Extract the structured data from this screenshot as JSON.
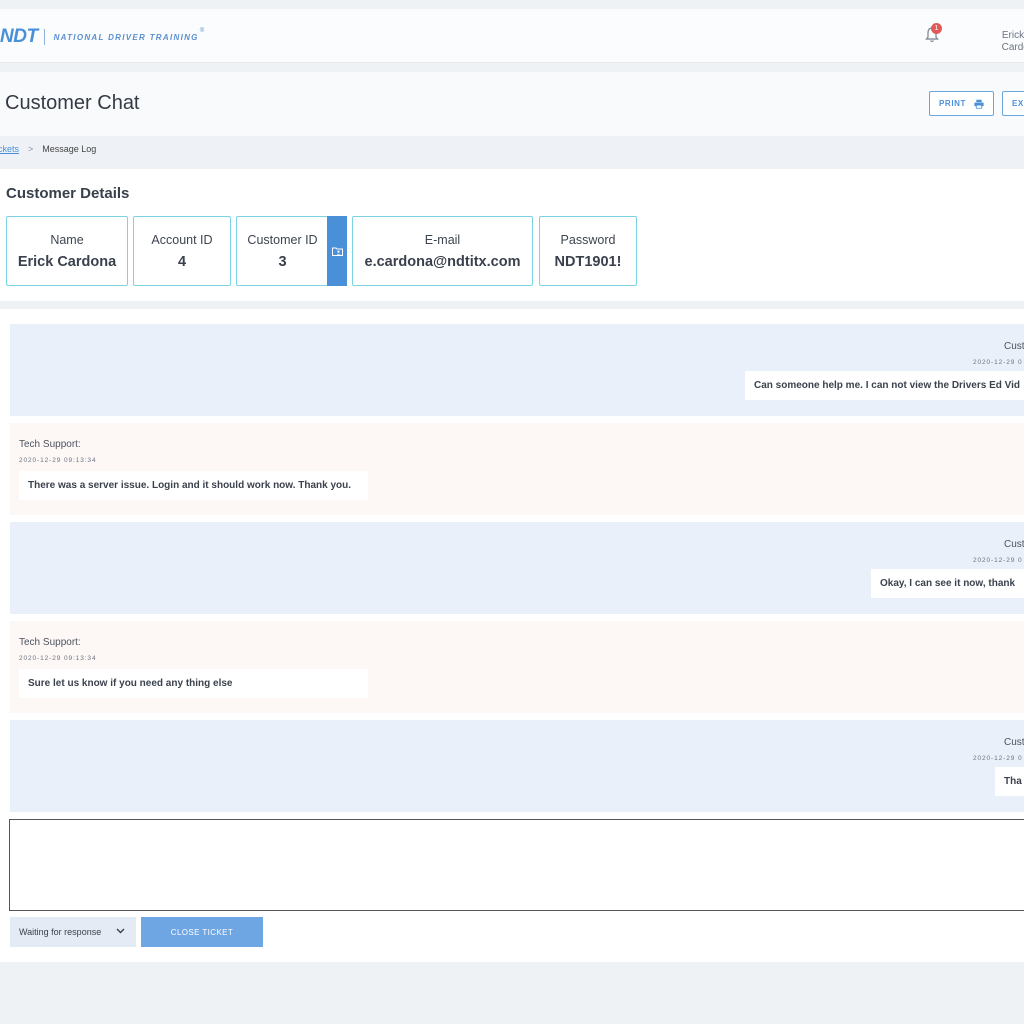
{
  "header": {
    "logo_mark": "NDT",
    "logo_text": "National Driver Training",
    "logo_reg": "®",
    "notification_count": "1",
    "user_first": "Erick C",
    "user_last": "Cardon"
  },
  "page": {
    "title": "Customer Chat",
    "print_label": "PRINT",
    "exit_label": "EXI"
  },
  "breadcrumb": {
    "link": "ckets",
    "separator": ">",
    "current": "Message Log"
  },
  "customer": {
    "section_title": "Customer Details",
    "fields": [
      {
        "label": "Name",
        "value": "Erick Cardona"
      },
      {
        "label": "Account ID",
        "value": "4"
      },
      {
        "label": "Customer ID",
        "value": "3"
      },
      {
        "label": "E-mail",
        "value": "e.cardona@ndtitx.com"
      },
      {
        "label": "Password",
        "value": "NDT1901!"
      }
    ]
  },
  "messages": [
    {
      "sender": "Cust",
      "timestamp": "2020-12-29 0",
      "text": "Can someone help me. I can not view the Drivers Ed Vid"
    },
    {
      "sender": "Tech Support:",
      "timestamp": "2020-12-29 09:13:34",
      "text": "There was a server issue. Login and it should work now. Thank you."
    },
    {
      "sender": "Cust",
      "timestamp": "2020-12-29 0",
      "text": "Okay, I can see it now, thank"
    },
    {
      "sender": "Tech Support:",
      "timestamp": "2020-12-29 09:13:34",
      "text": "Sure let us know if you need any thing else"
    },
    {
      "sender": "Cust",
      "timestamp": "2020-12-29 0",
      "text": "Tha"
    }
  ],
  "footer": {
    "status_value": "Waiting for response",
    "close_label": "CLOSE TICKET"
  },
  "colors": {
    "accent": "#4a90d9",
    "card_border": "#7cd3e3",
    "customer_bg": "#eaf0fa",
    "support_bg": "#fdf7f6",
    "badge": "#e05a5a"
  }
}
